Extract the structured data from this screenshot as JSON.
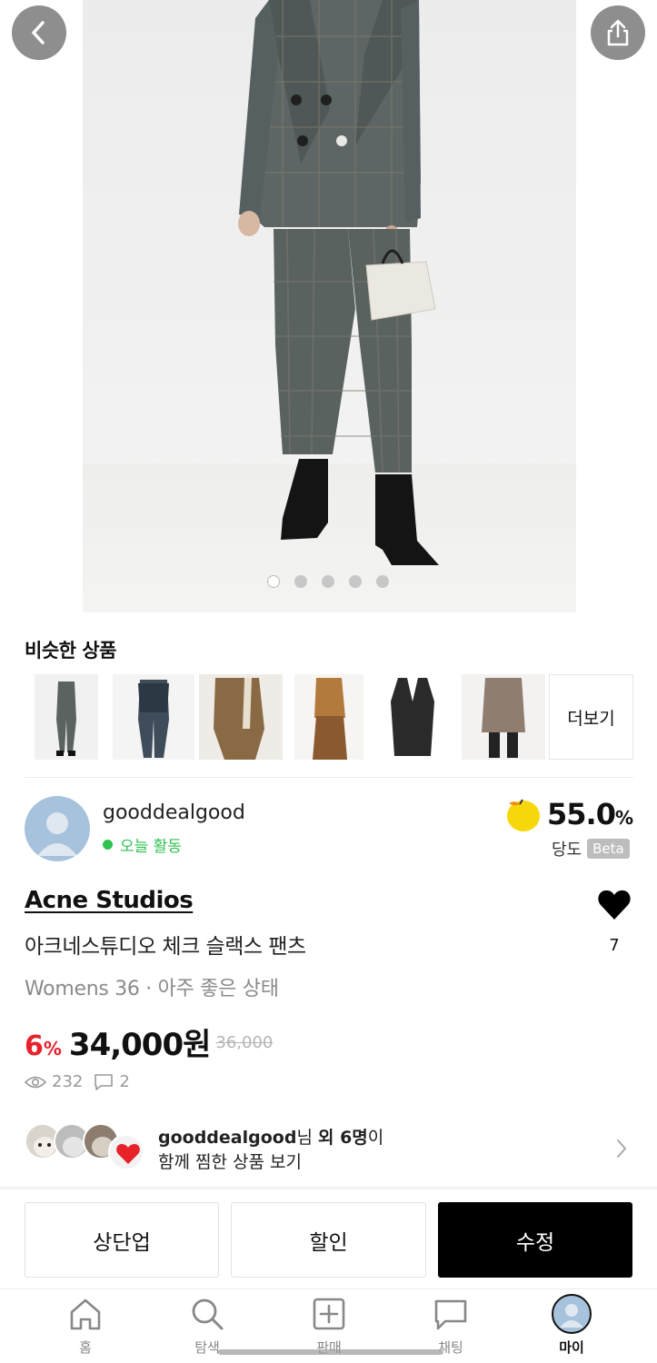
{
  "nav": {
    "back_icon": "chevron-left-icon",
    "share_icon": "share-icon"
  },
  "gallery": {
    "total_images": 5,
    "active_index": 0
  },
  "similar": {
    "title": "비슷한 상품",
    "more_label": "더보기"
  },
  "seller": {
    "name": "gooddealgood",
    "activity": "오늘 활동",
    "score": "55.0",
    "score_unit": "%",
    "score_label": "당도",
    "beta": "Beta"
  },
  "product": {
    "brand": "Acne Studios",
    "title": "아크네스튜디오 체크 슬랙스 팬츠",
    "subtitle": "Womens 36 · 아주 좋은 상태",
    "discount": "6",
    "discount_unit": "%",
    "price": "34,000원",
    "original_price": "36,000",
    "views": "232",
    "comments": "2",
    "likes": "7"
  },
  "wishlist": {
    "user": "gooddealgood",
    "suffix_nim": "님 ",
    "others": "외 6명",
    "suffix_i": "이",
    "line2": "함께 찜한 상품 보기"
  },
  "actions": {
    "bump": "상단업",
    "discount": "할인",
    "edit": "수정"
  },
  "tabbar": {
    "home": "홈",
    "search": "탐색",
    "sell": "판매",
    "chat": "채팅",
    "my": "마이"
  },
  "colors": {
    "accent_red": "#e8222b",
    "online_green": "#2fc44f",
    "primary_button": "#000000"
  }
}
